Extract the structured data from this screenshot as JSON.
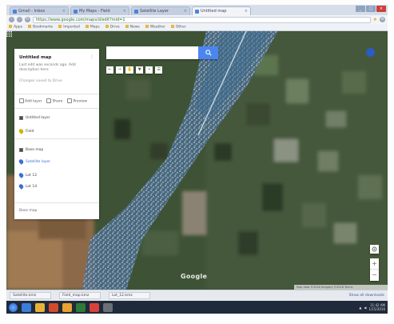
{
  "browser": {
    "tabs": [
      {
        "label": "Gmail - Inbox",
        "active": false
      },
      {
        "label": "My Maps - Field",
        "active": false
      },
      {
        "label": "Satellite Layer",
        "active": false
      },
      {
        "label": "Untitled map",
        "active": true
      }
    ],
    "address": "https://www.google.com/maps/d/edit?mid=1",
    "bookmarks": [
      "Apps",
      "Bookmarks",
      "Imported",
      "Maps",
      "Drive",
      "News",
      "Weather",
      "Other"
    ]
  },
  "search": {
    "placeholder": "",
    "value": ""
  },
  "tools": [
    "←",
    "→",
    "✋",
    "▼",
    "•",
    "☰"
  ],
  "panel": {
    "title": "Untitled map",
    "description": "Last edit was seconds ago. Add description here",
    "subtitle": "Changes saved to Drive",
    "actions": [
      "Add layer",
      "Share",
      "Preview"
    ],
    "layers": [
      {
        "label": "Untitled layer",
        "checked": true,
        "color": "#4a4a4a"
      },
      {
        "label": "Field",
        "checked": false,
        "color": "#c8b800"
      },
      {
        "label": "Base map",
        "checked": true,
        "color": "#4a4a4a"
      },
      {
        "label": "Satellite layer",
        "checked": false,
        "color": "#3b6fd8"
      },
      {
        "label": "Lot 12",
        "checked": false,
        "color": "#3b6fd8"
      },
      {
        "label": "Lot 14",
        "checked": false,
        "color": "#3b6fd8"
      }
    ],
    "footer": "Base map"
  },
  "map": {
    "logo": "Google",
    "footer": "Map data ©2016 Imagery ©2016 Terms",
    "zoom_in": "+",
    "zoom_out": "−"
  },
  "downloads": {
    "items": [
      "Satellite.kmz",
      "Field_map.kmz",
      "Lot_12.kmz"
    ],
    "show_all": "Show all downloads"
  },
  "taskbar": {
    "time": "11:42 AM",
    "date": "1/15/2016"
  }
}
